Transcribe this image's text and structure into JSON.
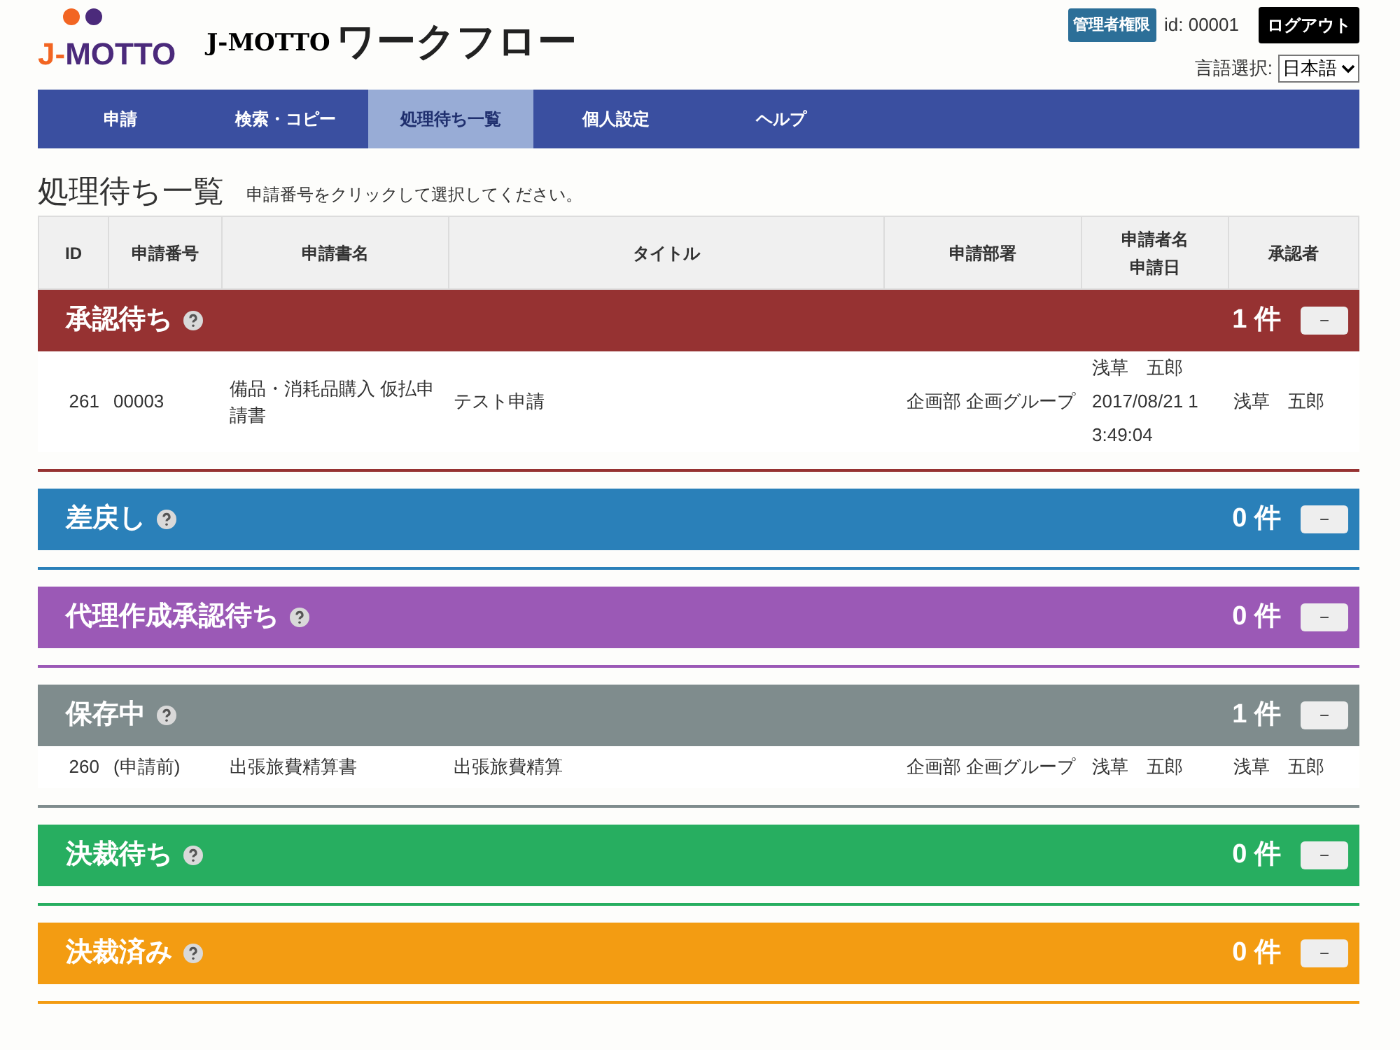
{
  "logo": {
    "prefix": "J-",
    "name": "MOTTO"
  },
  "app_title": {
    "brand": "J-MOTTO",
    "name": "ワークフロー"
  },
  "header": {
    "admin_badge": "管理者権限",
    "user_id": "id: 00001",
    "logout": "ログアウト",
    "language_label": "言語選択:",
    "language_value": "日本語"
  },
  "nav": [
    {
      "label": "申請",
      "selected": false
    },
    {
      "label": "検索・コピー",
      "selected": false
    },
    {
      "label": "処理待ち一覧",
      "selected": true
    },
    {
      "label": "個人設定",
      "selected": false
    },
    {
      "label": "ヘルプ",
      "selected": false
    }
  ],
  "page": {
    "title": "処理待ち一覧",
    "hint": "申請番号をクリックして選択してください。"
  },
  "table": {
    "columns": [
      [
        "ID"
      ],
      [
        "申請番号"
      ],
      [
        "申請書名"
      ],
      [
        "タイトル"
      ],
      [
        "申請部署"
      ],
      [
        "申請者名",
        "申請日"
      ],
      [
        "承認者"
      ]
    ],
    "sections": [
      {
        "name": "承認待ち",
        "count": "1 件",
        "color": "#963232",
        "collapse": "−",
        "rows": [
          {
            "id": "261",
            "number": "00003",
            "form": "備品・消耗品購入 仮払申請書",
            "title": "テスト申請",
            "department": "企画部 企画グループ",
            "applicant": "浅草　五郎",
            "date": "2017/08/21 13:49:04",
            "approver": "浅草　五郎"
          }
        ]
      },
      {
        "name": "差戻し",
        "count": "0 件",
        "color": "#2a80b9",
        "collapse": "−"
      },
      {
        "name": "代理作成承認待ち",
        "count": "0 件",
        "color": "#9b59b6",
        "collapse": "−"
      },
      {
        "name": "保存中",
        "count": "1 件",
        "color": "#7f8c8d",
        "collapse": "−",
        "rows": [
          {
            "id": "260",
            "number": "(申請前)",
            "form": "出張旅費精算書",
            "title": "出張旅費精算",
            "department": "企画部 企画グループ",
            "applicant": "浅草　五郎",
            "approver": "浅草　五郎"
          }
        ]
      },
      {
        "name": "決裁待ち",
        "count": "0 件",
        "color": "#27ae60",
        "collapse": "−"
      },
      {
        "name": "決裁済み",
        "count": "0 件",
        "color": "#f39c12",
        "collapse": "−"
      }
    ]
  }
}
